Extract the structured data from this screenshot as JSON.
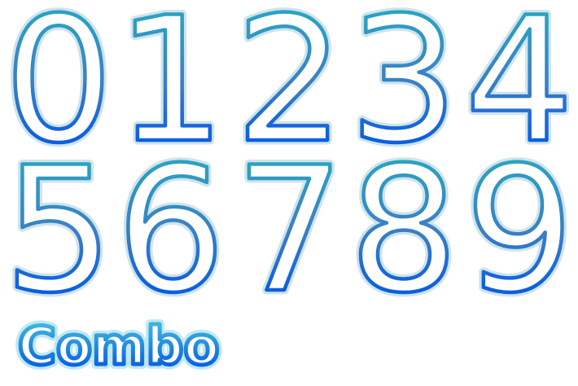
{
  "sprite_sheet": {
    "digits": [
      "0",
      "1",
      "2",
      "3",
      "4",
      "5",
      "6",
      "7",
      "8",
      "9"
    ],
    "combo_label": "Combo"
  },
  "colors": {
    "background": "#ffffff",
    "digit_gradient_top": "#2aa2c4",
    "digit_gradient_bottom": "#0b5fe0",
    "digit_glow": "#cfe4ea",
    "digit_fill": "#ffffff",
    "combo_gradient_top": "#3fb5dd",
    "combo_gradient_bottom": "#0a5fe0",
    "combo_glow": "#bfe9f3"
  }
}
